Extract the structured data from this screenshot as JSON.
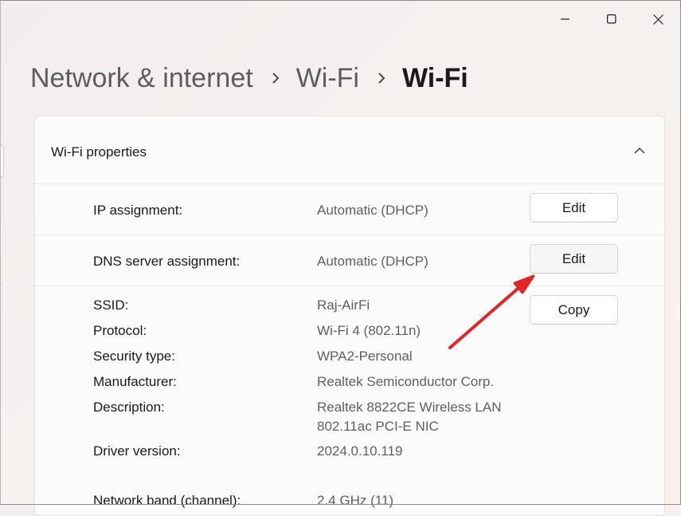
{
  "window_controls": {
    "minimize": "minimize-icon",
    "maximize": "maximize-icon",
    "close": "close-icon"
  },
  "breadcrumb": {
    "items": [
      "Network & internet",
      "Wi-Fi"
    ],
    "current": "Wi-Fi"
  },
  "card": {
    "title": "Wi-Fi properties",
    "rows": [
      {
        "label": "IP assignment:",
        "value": "Automatic (DHCP)",
        "button": "Edit"
      },
      {
        "label": "DNS server assignment:",
        "value": "Automatic (DHCP)",
        "button": "Edit"
      }
    ],
    "copy_button": "Copy",
    "properties": [
      {
        "label": "SSID:",
        "value": "Raj-AirFi"
      },
      {
        "label": "Protocol:",
        "value": "Wi-Fi 4 (802.11n)"
      },
      {
        "label": "Security type:",
        "value": "WPA2-Personal"
      },
      {
        "label": "Manufacturer:",
        "value": "Realtek Semiconductor Corp."
      },
      {
        "label": "Description:",
        "value": "Realtek 8822CE Wireless LAN",
        "value2": "802.11ac PCI-E NIC"
      },
      {
        "label": "Driver version:",
        "value": "2024.0.10.119"
      },
      {
        "label": "Network band (channel):",
        "value": "2.4 GHz (11)"
      }
    ]
  },
  "annotation": {
    "color": "#e02626"
  }
}
